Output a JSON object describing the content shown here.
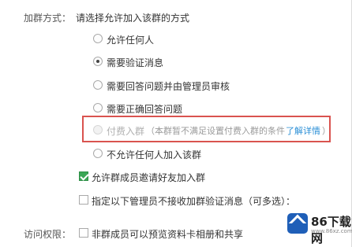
{
  "join_method": {
    "label": "加群方式：",
    "prompt": "请选择允许加入该群的方式",
    "options": [
      {
        "label": "允许任何人",
        "checked": false,
        "disabled": false
      },
      {
        "label": "需要验证消息",
        "checked": true,
        "disabled": false
      },
      {
        "label": "需要回答问题并由管理员审核",
        "checked": false,
        "disabled": false
      },
      {
        "label": "需要正确回答问题",
        "checked": false,
        "disabled": false
      },
      {
        "label": "付费入群",
        "checked": false,
        "disabled": true
      },
      {
        "label": "不允许任何人加入该群",
        "checked": false,
        "disabled": false
      }
    ],
    "paid_note_prefix": "（本群暂不满足设置付费入群的条件",
    "paid_note_link": "了解详情",
    "paid_note_suffix": "）"
  },
  "checkboxes": [
    {
      "label": "允许群成员邀请好友加入群",
      "checked": true
    },
    {
      "label": "指定以下管理员不接收加群验证消息（可多选）：",
      "checked": false
    }
  ],
  "access": {
    "label": "访问权限：",
    "option": {
      "label": "非群成员可以预览资料卡相册和共享",
      "checked": false
    }
  },
  "watermark": {
    "brand": "86下载网",
    "url": "www.86xz.com"
  },
  "colors": {
    "accent_link": "#2b8fd6",
    "highlight_border": "#d9534f",
    "checkbox_checked": "#3aa655"
  }
}
